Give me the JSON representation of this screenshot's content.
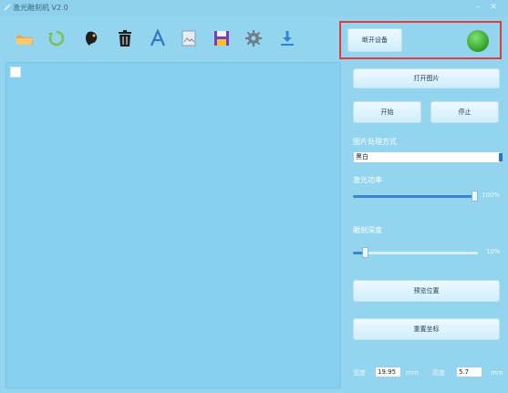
{
  "window": {
    "title": "激光雕刻机 V2.0"
  },
  "toolbar": {
    "items": [
      {
        "name": "open-folder-icon"
      },
      {
        "name": "undo-icon"
      },
      {
        "name": "paint-icon"
      },
      {
        "name": "trash-icon"
      },
      {
        "name": "text-icon"
      },
      {
        "name": "image-icon"
      },
      {
        "name": "save-icon"
      },
      {
        "name": "gear-icon"
      },
      {
        "name": "download-icon"
      }
    ]
  },
  "panel": {
    "open_device": "断开设备",
    "open_image": "打开图片",
    "start": "开始",
    "stop": "停止",
    "processing_label": "图片处理方式",
    "processing_value": "黑白",
    "laser_power_label": "激光功率",
    "laser_power_value": "100%",
    "laser_power_fraction": 1.0,
    "depth_label": "雕刻深度",
    "depth_value": "10%",
    "depth_fraction": 0.1,
    "preview": "预览位置",
    "reset": "重置坐标",
    "width_label": "宽度",
    "width_value": "19.95",
    "width_unit": "mm",
    "height_label": "高度",
    "height_value": "5.7",
    "height_unit": "mm"
  },
  "colors": {
    "device_led": "#2f9d2a",
    "highlight": "#e53a3a"
  }
}
